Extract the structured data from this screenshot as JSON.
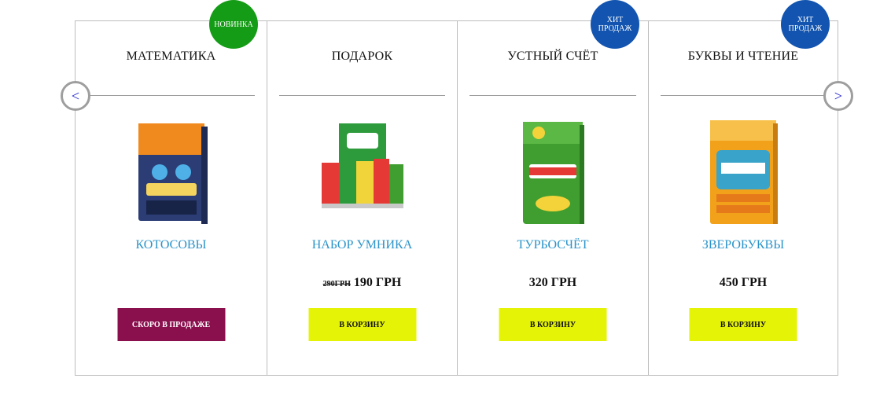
{
  "nav": {
    "prev_label": "<",
    "next_label": ">"
  },
  "products": [
    {
      "category": "МАТЕМАТИКА",
      "badge": "НОВИНКА",
      "name": "КОТОСОВЫ",
      "old_price": "",
      "price": "",
      "button": "СКОРО В ПРОДАЖЕ",
      "box_title": "Котосовы",
      "box_color": "#2b3d74",
      "box_accent": "#f08a1e"
    },
    {
      "category": "ПОДАРОК",
      "badge": "",
      "name": "НАБОР УМНИКА",
      "old_price": "290ГРН",
      "price": "190 ГРН",
      "button": "В КОРЗИНУ",
      "box_title": "Набор умника",
      "box_color": "#2d9a3c",
      "box_accent": "#e53935"
    },
    {
      "category": "УСТНЫЙ СЧЁТ",
      "badge": "ХИТ ПРОДАЖ",
      "name": "ТУРБОСЧЁТ",
      "old_price": "",
      "price": "320 ГРН",
      "button": "В КОРЗИНУ",
      "box_title": "Турбосчёт",
      "box_color": "#3f9e2f",
      "box_accent": "#f4d23a"
    },
    {
      "category": "БУКВЫ И ЧТЕНИЕ",
      "badge": "ХИТ ПРОДАЖ",
      "name": "ЗВЕРОБУКВЫ",
      "old_price": "",
      "price": "450 ГРН",
      "button": "В КОРЗИНУ",
      "box_title": "Зверобуквы",
      "box_color": "#f2a21a",
      "box_accent": "#39a3c9"
    }
  ]
}
